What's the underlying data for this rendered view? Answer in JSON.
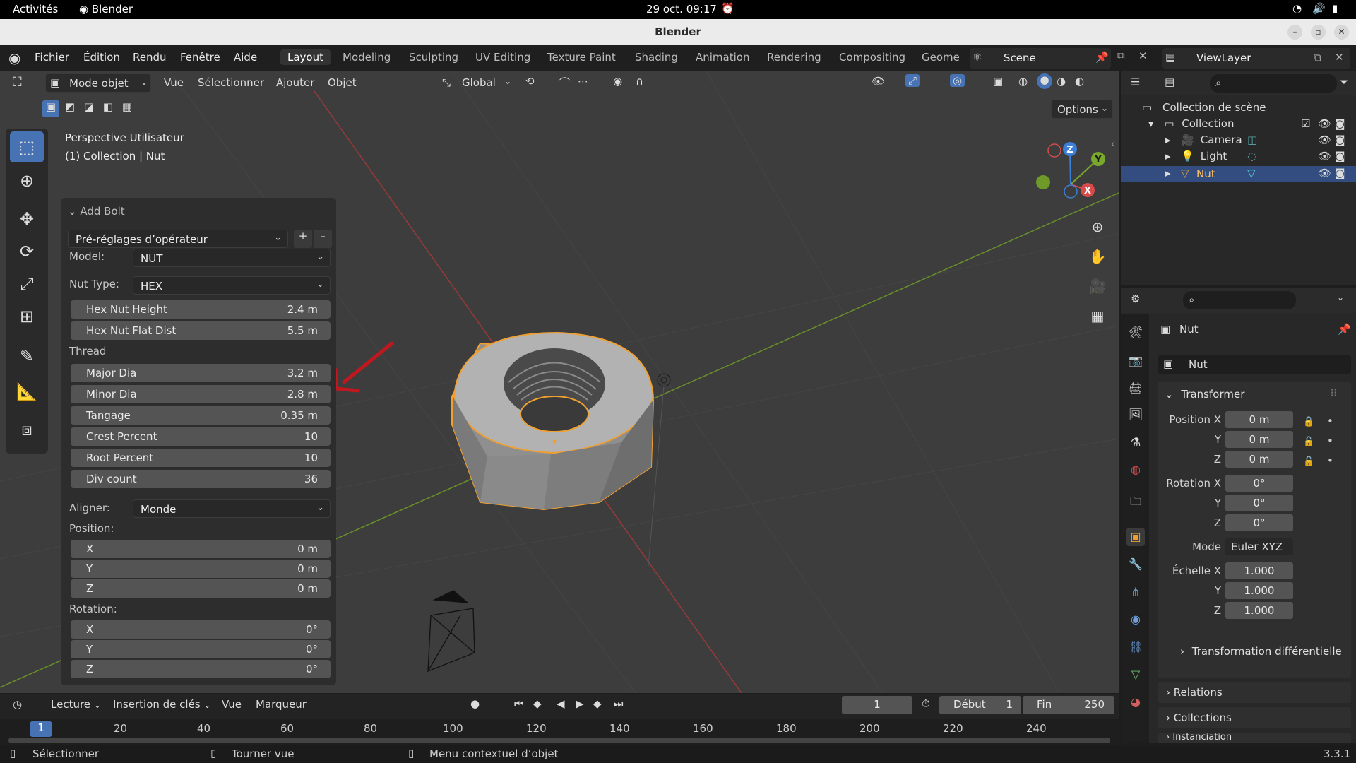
{
  "gnome_bar": {
    "activities": "Activités",
    "app": "Blender",
    "clock": "29 oct. 09:17"
  },
  "window": {
    "title": "Blender"
  },
  "menu": {
    "items": [
      "Fichier",
      "Édition",
      "Rendu",
      "Fenêtre",
      "Aide"
    ]
  },
  "workspaces": [
    "Layout",
    "Modeling",
    "Sculpting",
    "UV Editing",
    "Texture Paint",
    "Shading",
    "Animation",
    "Rendering",
    "Compositing",
    "Geome"
  ],
  "scene": "Scene",
  "view_layer": "ViewLayer",
  "viewport_header": {
    "mode": "Mode objet",
    "menus": [
      "Vue",
      "Sélectionner",
      "Ajouter",
      "Objet"
    ],
    "orientation": "Global",
    "options": "Options"
  },
  "viewport_info": {
    "line1": "Perspective Utilisateur",
    "line2": "(1) Collection | Nut"
  },
  "gizmo": {
    "x": "X",
    "y": "Y",
    "z": "Z"
  },
  "operator_panel": {
    "title": "Add Bolt",
    "presets": "Pré-réglages d’opérateur",
    "model_label": "Model:",
    "model_value": "NUT",
    "nut_type_label": "Nut Type:",
    "nut_type_value": "HEX",
    "hex_nut_height": {
      "label": "Hex Nut Height",
      "value": "2.4 m"
    },
    "hex_nut_flat_dist": {
      "label": "Hex Nut Flat Dist",
      "value": "5.5 m"
    },
    "thread_label": "Thread",
    "major_dia": {
      "label": "Major Dia",
      "value": "3.2 m"
    },
    "minor_dia": {
      "label": "Minor Dia",
      "value": "2.8 m"
    },
    "tangage": {
      "label": "Tangage",
      "value": "0.35 m"
    },
    "crest_percent": {
      "label": "Crest Percent",
      "value": "10"
    },
    "root_percent": {
      "label": "Root Percent",
      "value": "10"
    },
    "div_count": {
      "label": "Div count",
      "value": "36"
    },
    "align_label": "Aligner:",
    "align_value": "Monde",
    "position_label": "Position:",
    "position": [
      {
        "axis": "X",
        "value": "0 m"
      },
      {
        "axis": "Y",
        "value": "0 m"
      },
      {
        "axis": "Z",
        "value": "0 m"
      }
    ],
    "rotation_label": "Rotation:",
    "rotation": [
      {
        "axis": "X",
        "value": "0°"
      },
      {
        "axis": "Y",
        "value": "0°"
      },
      {
        "axis": "Z",
        "value": "0°"
      }
    ]
  },
  "outliner": {
    "root": "Collection de scène",
    "collection": "Collection",
    "items": [
      "Camera",
      "Light",
      "Nut"
    ]
  },
  "properties": {
    "object_name": "Nut",
    "object_field": "Nut",
    "transform_title": "Transformer",
    "position_x_label": "Position X",
    "y_label": "Y",
    "z_label": "Z",
    "position": [
      "0 m",
      "0 m",
      "0 m"
    ],
    "rotation_x_label": "Rotation X",
    "rotation": [
      "0°",
      "0°",
      "0°"
    ],
    "mode_label": "Mode",
    "mode_value": "Euler XYZ",
    "scale_x_label": "Échelle X",
    "scale": [
      "1.000",
      "1.000",
      "1.000"
    ],
    "delta_transform": "Transformation différentielle",
    "relations": "Relations",
    "collections": "Collections",
    "instancing": "Instanciation"
  },
  "timeline": {
    "menus": [
      "Lecture",
      "Insertion de clés",
      "Vue",
      "Marqueur"
    ],
    "current_frame": "1",
    "start_label": "Début",
    "start": "1",
    "end_label": "Fin",
    "end": "250",
    "ticks": [
      "20",
      "40",
      "60",
      "80",
      "100",
      "120",
      "140",
      "160",
      "180",
      "200",
      "220",
      "240"
    ],
    "playhead": "1"
  },
  "status_bar": {
    "select": "Sélectionner",
    "rotate": "Tourner vue",
    "context": "Menu contextuel d’objet",
    "version": "3.3.1"
  },
  "colors": {
    "accent": "#4772b3",
    "selection_outline": "#f0a030",
    "arrow": "#c0181e",
    "viewport_bg": "#3d3d3d"
  }
}
